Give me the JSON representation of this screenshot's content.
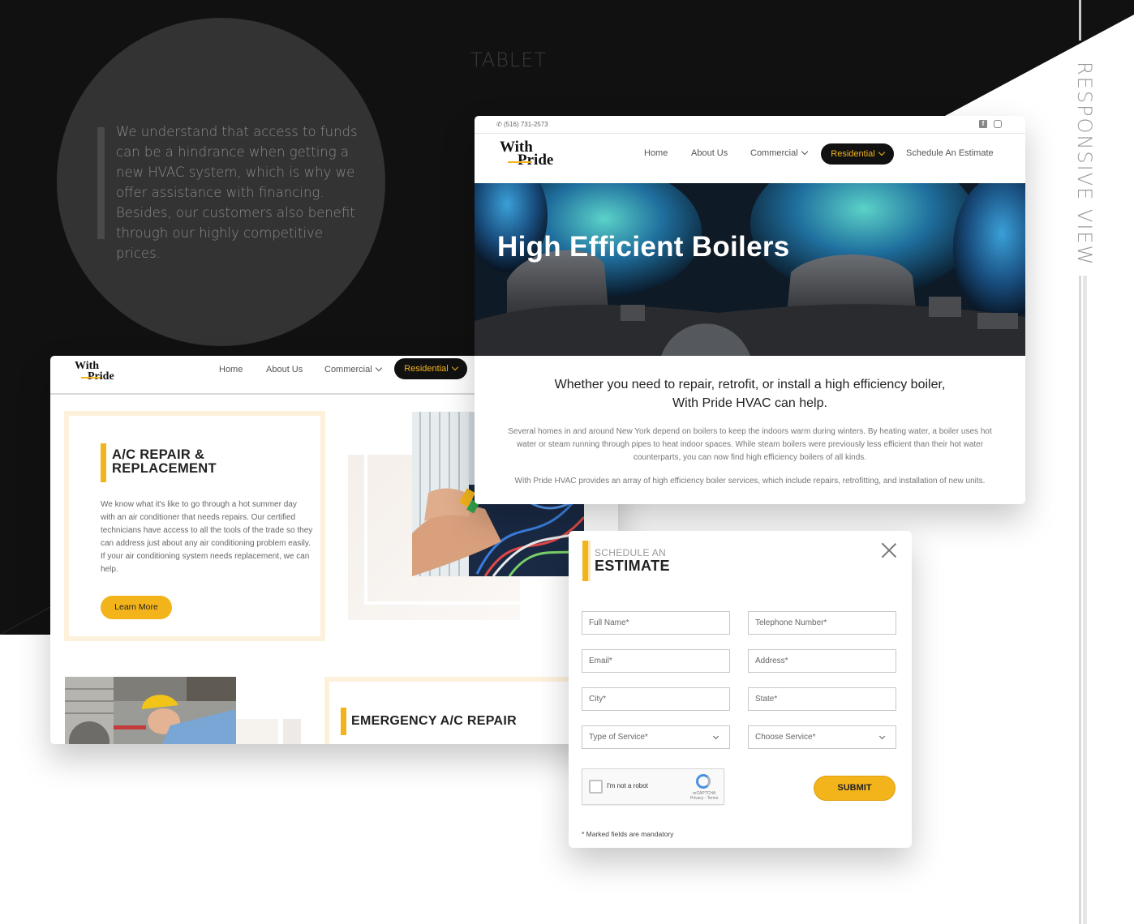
{
  "labels": {
    "tablet": "TABLET",
    "responsive_view": "RESPONSIVE VIEW"
  },
  "quote": {
    "text": "We understand that access to funds can be a hindrance when getting a new HVAC system, which is why we offer assistance with financing. Besides, our customers also benefit through our highly competitive prices."
  },
  "brand": {
    "logo_line1": "With",
    "logo_line2": "Pride",
    "accent": "#f3b41b",
    "dark": "#111111"
  },
  "left_mock": {
    "nav": {
      "home": "Home",
      "about": "About Us",
      "commercial": "Commercial",
      "residential": "Residential"
    },
    "ac_card": {
      "title_line1": "A/C REPAIR &",
      "title_line2": "REPLACEMENT",
      "body": "We know what it's like to go through a hot summer day with an air conditioner that needs repairs. Our certified technicians have access to all the tools of the trade so they can address just about any air conditioning problem easily. If your air conditioning system needs replacement, we can help.",
      "button": "Learn More"
    },
    "emergency_card": {
      "title": "EMERGENCY A/C REPAIR"
    }
  },
  "right_mock": {
    "phone": "(516) 731-2573",
    "social": [
      "facebook-icon",
      "instagram-icon"
    ],
    "nav": {
      "home": "Home",
      "about": "About Us",
      "commercial": "Commercial",
      "residential": "Residential",
      "schedule": "Schedule An Estimate"
    },
    "hero_title": "High Efficient Boilers",
    "heading_line1": "Whether you need to repair, retrofit, or install a high efficiency boiler,",
    "heading_line2": "With Pride HVAC can help.",
    "paragraph1": "Several homes in and around New York depend on boilers to keep the indoors warm during winters. By heating water, a boiler uses hot water or steam running through pipes to heat indoor spaces. While steam boilers were previously less efficient than their hot water counterparts, you can now find high efficiency boilers of all kinds.",
    "paragraph2": "With Pride HVAC provides an array of high efficiency boiler services, which include repairs, retrofitting, and installation of new units."
  },
  "form": {
    "subtitle": "SCHEDULE AN",
    "title": "ESTIMATE",
    "fields": {
      "full_name": "Full Name*",
      "telephone": "Telephone Number*",
      "email": "Email*",
      "address": "Address*",
      "city": "City*",
      "state": "State*",
      "type_of_service": "Type of Service*",
      "choose_service": "Choose Service*"
    },
    "captcha": {
      "label": "I'm not a robot",
      "brand": "reCAPTCHA",
      "links": "Privacy - Terms"
    },
    "submit": "SUBMIT",
    "mandatory_note": "* Marked fields are mandatory"
  }
}
